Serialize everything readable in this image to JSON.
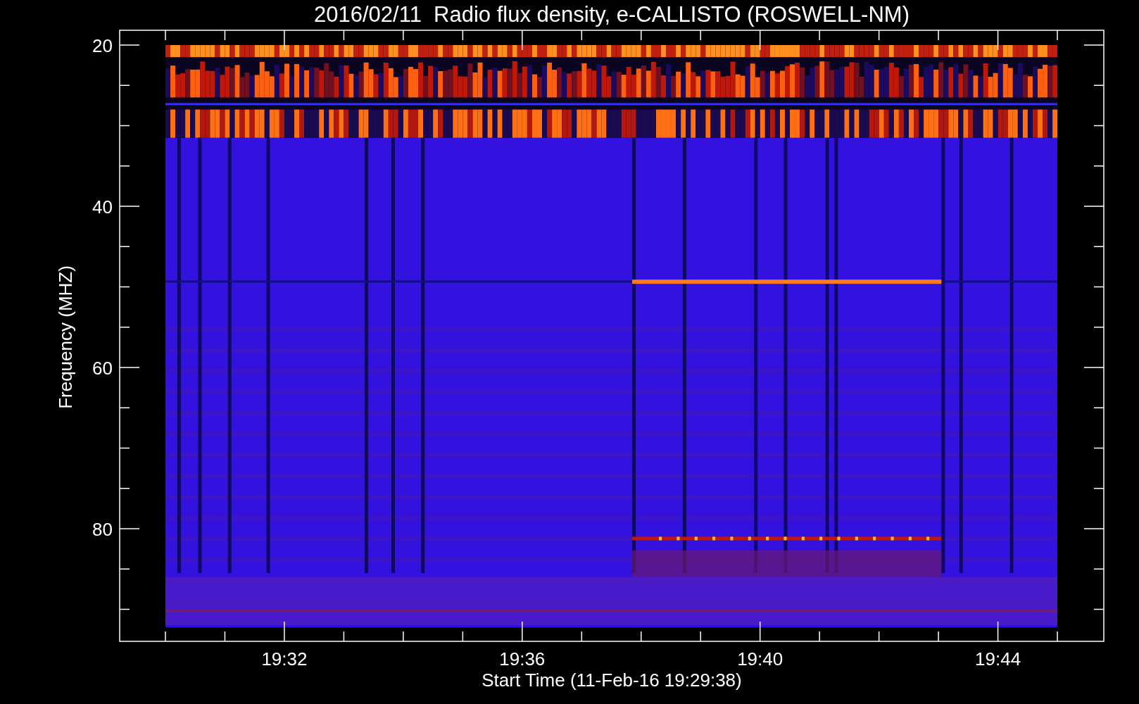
{
  "title": "2016/02/11  Radio flux density, e-CALLISTO (ROSWELL-NM)",
  "y_axis": {
    "label": "Frequency (MHZ)",
    "ticks": [
      "20",
      "40",
      "60",
      "80"
    ]
  },
  "x_axis": {
    "label": "Start Time (11-Feb-16 19:29:38)",
    "ticks": [
      "19:32",
      "19:36",
      "19:40",
      "19:44"
    ]
  }
}
